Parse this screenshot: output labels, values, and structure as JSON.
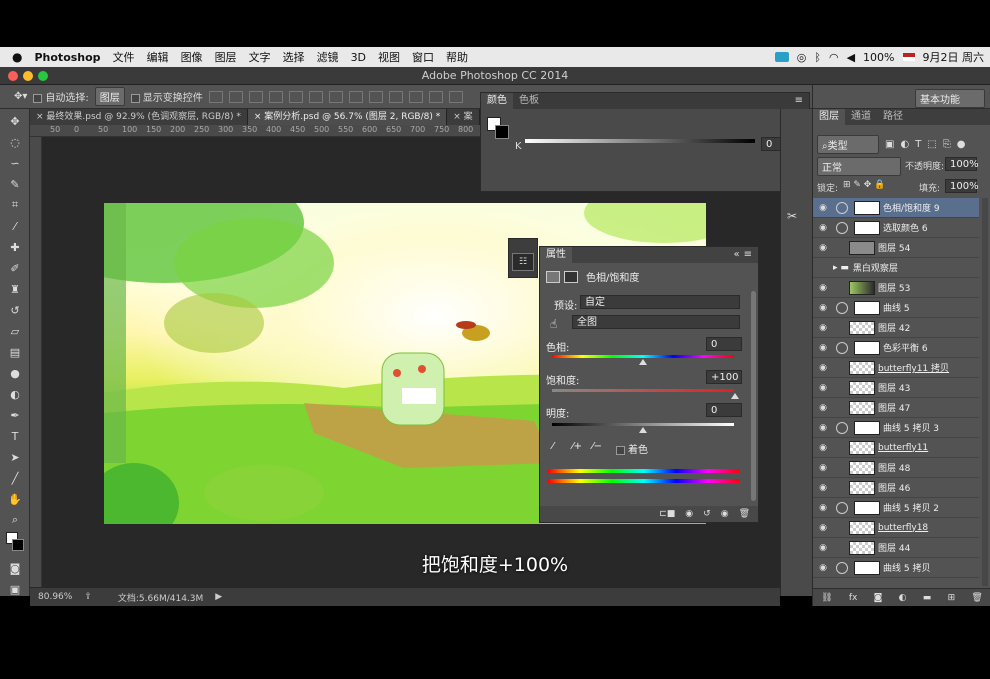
{
  "menubar": {
    "apple": "",
    "app": "Photoshop",
    "items": [
      "文件",
      "编辑",
      "图像",
      "图层",
      "文字",
      "选择",
      "滤镜",
      "3D",
      "视图",
      "窗口",
      "帮助"
    ],
    "battery": "100%",
    "date": "9月2日 周六"
  },
  "window": {
    "title": "Adobe Photoshop CC 2014"
  },
  "options": {
    "auto_select_label": "自动选择:",
    "auto_select_value": "图层",
    "show_transform_label": "显示变换控件",
    "workspace": "基本功能"
  },
  "tabs": [
    {
      "label": "最终效果.psd @ 92.9% (色调观察层, RGB/8) *"
    },
    {
      "label": "案例分析.psd @ 56.7% (图层 2, RGB/8) *"
    },
    {
      "label": "案"
    }
  ],
  "ruler": {
    "h_ticks": [
      "50",
      "0",
      "50",
      "100",
      "150",
      "200",
      "250",
      "300",
      "350",
      "400",
      "450",
      "500",
      "550",
      "600",
      "650",
      "700",
      "750",
      "800",
      "850",
      "900",
      "950",
      "1000",
      "1050"
    ]
  },
  "color_panel": {
    "tabs": [
      "颜色",
      "色板"
    ],
    "channel": "K",
    "value": "0",
    "unit": "%"
  },
  "properties": {
    "tab": "属性",
    "title": "色相/饱和度",
    "preset_label": "预设:",
    "preset_value": "自定",
    "range_value": "全图",
    "hue_label": "色相:",
    "hue_value": "0",
    "saturation_label": "饱和度:",
    "saturation_value": "+100",
    "lightness_label": "明度:",
    "lightness_value": "0",
    "colorize_label": "着色"
  },
  "status": {
    "zoom": "80.96%",
    "doc": "文档:5.66M/414.3M"
  },
  "subtitle": "把饱和度+100%",
  "layers_panel": {
    "tabs": [
      "图层",
      "通道",
      "路径"
    ],
    "filter": "类型",
    "blend_mode": "正常",
    "opacity_label": "不透明度:",
    "opacity": "100%",
    "lock_label": "锁定:",
    "fill_label": "填充:",
    "fill": "100%",
    "layers": [
      {
        "name": "色相/饱和度 9",
        "kind": "adjust",
        "selected": true
      },
      {
        "name": "选取颜色 6",
        "kind": "adjust"
      },
      {
        "name": "图层 54",
        "kind": "gray"
      },
      {
        "name": "黑白观察层",
        "kind": "group"
      },
      {
        "name": "图层 53",
        "kind": "photo"
      },
      {
        "name": "曲线 5",
        "kind": "adjust"
      },
      {
        "name": "图层 42",
        "kind": "checker"
      },
      {
        "name": "色彩平衡 6",
        "kind": "adjust"
      },
      {
        "name": "butterfly11 拷贝",
        "kind": "smart"
      },
      {
        "name": "图层 43",
        "kind": "checker"
      },
      {
        "name": "图层 47",
        "kind": "checker"
      },
      {
        "name": "曲线 5 拷贝 3",
        "kind": "adjust"
      },
      {
        "name": "butterfly11",
        "kind": "smart"
      },
      {
        "name": "图层 48",
        "kind": "checker"
      },
      {
        "name": "图层 46",
        "kind": "checker"
      },
      {
        "name": "曲线 5 拷贝 2",
        "kind": "adjust"
      },
      {
        "name": "butterfly18",
        "kind": "smart"
      },
      {
        "name": "图层 44",
        "kind": "checker"
      },
      {
        "name": "曲线 5 拷贝",
        "kind": "adjust"
      }
    ],
    "footer_icons": [
      "link-icon",
      "fx-icon",
      "mask-icon",
      "adjustment-icon",
      "group-icon",
      "new-layer-icon",
      "trash-icon"
    ]
  },
  "colors": {
    "accent_selected": "#5a6f8e",
    "panel": "#535353"
  }
}
